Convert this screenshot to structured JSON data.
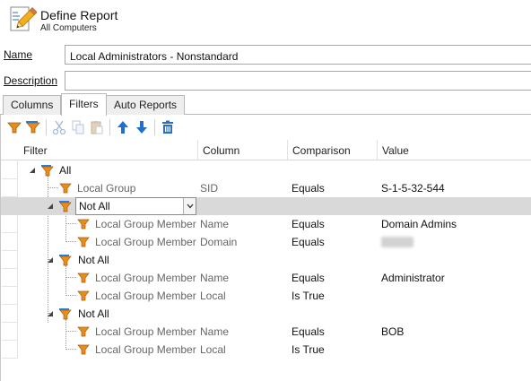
{
  "header": {
    "title": "Define Report",
    "subtitle": "All Computers",
    "icon": "report-pencil-icon"
  },
  "form": {
    "name_label": "Name",
    "name_value": "Local Administrators - Nonstandard",
    "description_label": "Description",
    "description_value": ""
  },
  "tabs": [
    {
      "label": "Columns",
      "active": false
    },
    {
      "label": "Filters",
      "active": true
    },
    {
      "label": "Auto Reports",
      "active": false
    }
  ],
  "toolbar": {
    "buttons": [
      "add-filter-icon",
      "add-filter-group-icon",
      "cut-icon",
      "copy-icon",
      "paste-icon",
      "move-up-icon",
      "move-down-icon",
      "delete-icon"
    ]
  },
  "grid": {
    "columns": [
      "Filter",
      "Column",
      "Comparison",
      "Value"
    ],
    "rows": [
      {
        "type": "group",
        "filter": "All",
        "column": "",
        "comparison": "",
        "value": ""
      },
      {
        "type": "condition",
        "filter": "Local Group",
        "column": "SID",
        "comparison": "Equals",
        "value": "S-1-5-32-544"
      },
      {
        "type": "group",
        "filter": "Not All",
        "column": "",
        "comparison": "",
        "value": "",
        "selected": true
      },
      {
        "type": "condition",
        "filter": "Local Group Member",
        "column": "Name",
        "comparison": "Equals",
        "value": "Domain Admins"
      },
      {
        "type": "condition",
        "filter": "Local Group Member",
        "column": "Domain",
        "comparison": "Equals",
        "value": ""
      },
      {
        "type": "group",
        "filter": "Not All",
        "column": "",
        "comparison": "",
        "value": ""
      },
      {
        "type": "condition",
        "filter": "Local Group Member",
        "column": "Name",
        "comparison": "Equals",
        "value": "Administrator"
      },
      {
        "type": "condition",
        "filter": "Local Group Member",
        "column": "Local",
        "comparison": "Is True",
        "value": ""
      },
      {
        "type": "group",
        "filter": "Not All",
        "column": "",
        "comparison": "",
        "value": ""
      },
      {
        "type": "condition",
        "filter": "Local Group Member",
        "column": "Name",
        "comparison": "Equals",
        "value": "BOB"
      },
      {
        "type": "condition",
        "filter": "Local Group Member",
        "column": "Local",
        "comparison": "Is True",
        "value": ""
      }
    ]
  },
  "colors": {
    "accent_blue": "#1e6fd0",
    "filter_orange": "#e0881a",
    "selected_row": "#d9d9d9"
  }
}
